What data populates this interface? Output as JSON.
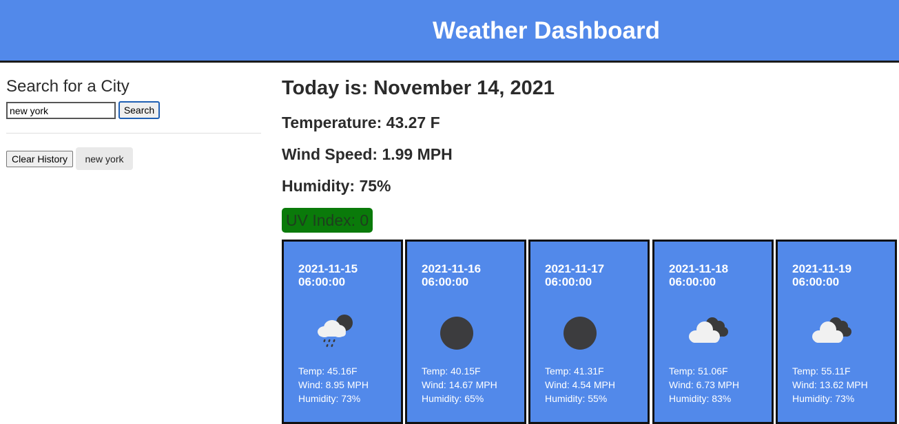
{
  "header": {
    "title": "Weather Dashboard"
  },
  "sidebar": {
    "search_title": "Search for a City",
    "search_value": "new york",
    "search_button": "Search",
    "clear_button": "Clear History",
    "history": [
      "new york"
    ]
  },
  "current": {
    "today": "Today is: November 14, 2021",
    "temperature": "Temperature: 43.27 F",
    "wind": "Wind Speed: 1.99 MPH",
    "humidity": "Humidity: 75%",
    "uv": "UV Index: 0",
    "uv_color": "#0a7a0a"
  },
  "forecast": [
    {
      "date": "2021-11-15 06:00:00",
      "icon": "rain-cloud-moon-icon",
      "temp": "Temp: 45.16F",
      "wind": "Wind: 8.95 MPH",
      "humidity": "Humidity: 73%"
    },
    {
      "date": "2021-11-16 06:00:00",
      "icon": "clear-night-icon",
      "temp": "Temp: 40.15F",
      "wind": "Wind: 14.67 MPH",
      "humidity": "Humidity: 65%"
    },
    {
      "date": "2021-11-17 06:00:00",
      "icon": "clear-night-icon",
      "temp": "Temp: 41.31F",
      "wind": "Wind: 4.54 MPH",
      "humidity": "Humidity: 55%"
    },
    {
      "date": "2021-11-18 06:00:00",
      "icon": "broken-clouds-icon",
      "temp": "Temp: 51.06F",
      "wind": "Wind: 6.73 MPH",
      "humidity": "Humidity: 83%"
    },
    {
      "date": "2021-11-19 06:00:00",
      "icon": "broken-clouds-icon",
      "temp": "Temp: 55.11F",
      "wind": "Wind: 13.62 MPH",
      "humidity": "Humidity: 73%"
    }
  ],
  "colors": {
    "header_bg": "#5289ea",
    "card_bg": "#5289ea",
    "uv_good": "#0a7a0a"
  }
}
